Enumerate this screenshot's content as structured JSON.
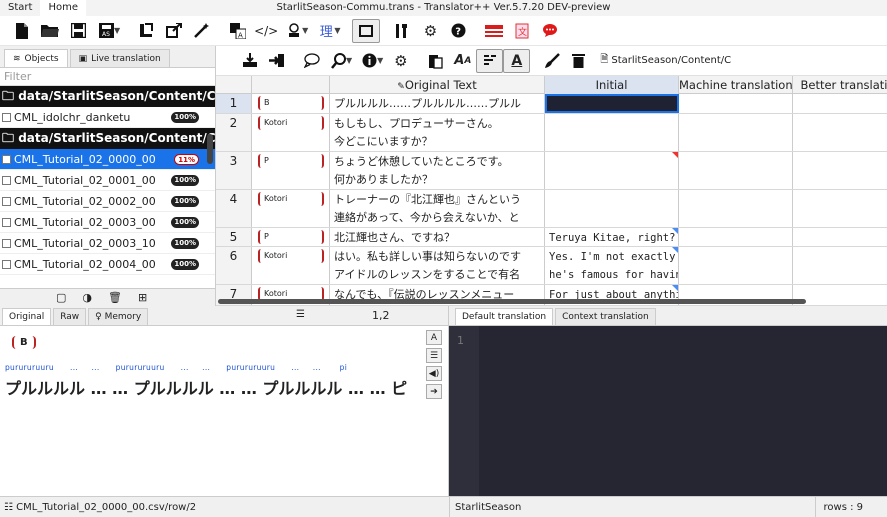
{
  "menu": {
    "start": "Start",
    "home": "Home"
  },
  "window": {
    "title": "StarlitSeason-Commu.trans - Translator++ Ver.5.7.20 DEV-preview"
  },
  "ribbon1": {
    "icons": [
      "new-file-icon",
      "open-folder-icon",
      "save-icon",
      "save-as-icon",
      "export-icon",
      "external-link-icon",
      "magic-wand-icon",
      "translate-icon",
      "code-icon",
      "stamp-icon",
      "kana-icon",
      "window-icon",
      "tools-icon",
      "settings-icon",
      "help-icon",
      "flag-icon",
      "book-icon",
      "chat-icon"
    ]
  },
  "left_panel": {
    "tabs": {
      "objects": "Objects",
      "live": "Live translation"
    },
    "filter_placeholder": "Filter",
    "folder1": "data/StarlitSeason/Content/Con",
    "folder2": "data/StarlitSeason/Content/Con",
    "files": [
      {
        "name": "CML_idolchr_danketu",
        "badge": "100%"
      },
      {
        "name": "CML_Tutorial_02_0000_00",
        "badge": "11%"
      },
      {
        "name": "CML_Tutorial_02_0001_00",
        "badge": "100%"
      },
      {
        "name": "CML_Tutorial_02_0002_00",
        "badge": "100%"
      },
      {
        "name": "CML_Tutorial_02_0003_00",
        "badge": "100%"
      },
      {
        "name": "CML_Tutorial_02_0003_10",
        "badge": "100%"
      },
      {
        "name": "CML_Tutorial_02_0004_00",
        "badge": "100%"
      }
    ]
  },
  "ribbon2": {
    "path": "StarlitSeason/Content/C"
  },
  "grid": {
    "headers": {
      "original": "Original Text",
      "initial": "Initial",
      "machine": "Machine translation",
      "better": "Better translatio"
    },
    "rows": [
      {
        "num": "1",
        "speaker": "B",
        "orig1": "プルルルル……プルルルル……プルル",
        "orig2": "",
        "init1": "",
        "init2": ""
      },
      {
        "num": "2",
        "speaker": "Kotori",
        "orig1": "もしもし、プロデューサーさん。",
        "orig2": "今どこにいますか？",
        "init1": "",
        "init2": ""
      },
      {
        "num": "3",
        "speaker": "P",
        "orig1": "ちょうど休憩していたところです。",
        "orig2": "何かありましたか？",
        "init1": "",
        "init2": ""
      },
      {
        "num": "4",
        "speaker": "Kotori",
        "orig1": "トレーナーの『北江輝也』さんという",
        "orig2": "連絡があって、今から会えないか、と",
        "init1": "",
        "init2": ""
      },
      {
        "num": "5",
        "speaker": "P",
        "orig1": "北江輝也さん、ですね？",
        "orig2": "",
        "init1": "Teruya Kitae, right?",
        "init2": ""
      },
      {
        "num": "6",
        "speaker": "Kotori",
        "orig1": "はい。私も詳しい事は知らないのです",
        "orig2": "アイドルのレッスンをすることで有名",
        "init1": "Yes. I'm not exactly",
        "init2": "he's famous for havin"
      },
      {
        "num": "7",
        "speaker": "Kotori",
        "orig1": "なんでも、『伝説のレッスンメニュー",
        "orig2": "",
        "init1": "For just about anythi",
        "init2": ""
      }
    ]
  },
  "bottom_left": {
    "tabs": {
      "original": "Original",
      "raw": "Raw",
      "memory": "Memory"
    },
    "position": "1,2",
    "speaker": "B",
    "furigana": "purururuuru      ...     ...      purururuuru      ...     ...      purururuuru      ...     ...       pi",
    "original": "プルルルル … … プルルルル … … プルルルル … … ピ"
  },
  "bottom_right": {
    "tabs": {
      "default": "Default translation",
      "context": "Context translation"
    },
    "line_number": "1"
  },
  "status": {
    "path": "CML_Tutorial_02_0000_00.csv/row/2",
    "project": "StarlitSeason",
    "rows": "rows : 9"
  }
}
